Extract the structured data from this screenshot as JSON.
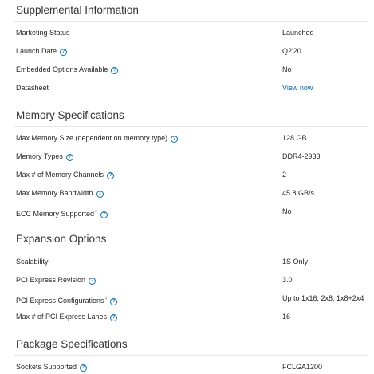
{
  "sections": [
    {
      "title": "Supplemental Information",
      "rows": [
        {
          "label": "Marketing Status",
          "value": "Launched"
        },
        {
          "label": "Launch Date",
          "value": "Q2'20"
        },
        {
          "label": "Embedded Options Available",
          "value": "No"
        },
        {
          "label": "Datasheet",
          "value": "View now"
        }
      ]
    },
    {
      "title": "Memory Specifications",
      "rows": [
        {
          "label": "Max Memory Size (dependent on memory type)",
          "value": "128 GB"
        },
        {
          "label": "Memory Types",
          "value": "DDR4-2933"
        },
        {
          "label": "Max # of Memory Channels",
          "value": "2"
        },
        {
          "label": "Max Memory Bandwidth",
          "value": "45.8 GB/s"
        },
        {
          "label": "ECC Memory Supported",
          "value": "No",
          "footnote": "‡"
        }
      ]
    },
    {
      "title": "Expansion Options",
      "rows": [
        {
          "label": "Scalability",
          "value": "1S Only"
        },
        {
          "label": "PCI Express Revision",
          "value": "3.0"
        },
        {
          "label": "PCI Express Configurations",
          "value": "Up to 1x16, 2x8, 1x8+2x4",
          "footnote": "‡"
        },
        {
          "label": "Max # of PCI Express Lanes",
          "value": "16"
        }
      ]
    },
    {
      "title": "Package Specifications",
      "rows": [
        {
          "label": "Sockets Supported",
          "value": "FCLGA1200"
        }
      ]
    }
  ],
  "help_icon_glyph": "?",
  "colors": {
    "link": "#0068b5",
    "help_icon": "#0071c5",
    "divider": "#e6e6e6",
    "text": "#262626"
  }
}
